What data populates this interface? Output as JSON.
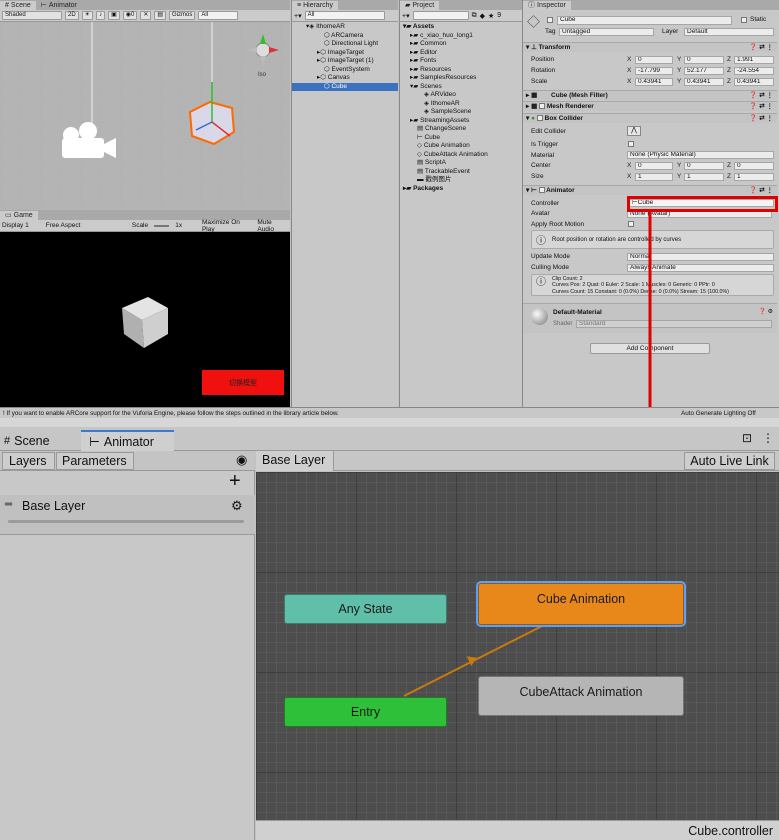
{
  "scene_view": {
    "tabs": [
      "Scene",
      "Animator"
    ],
    "toolbar": {
      "shading": "Shaded",
      "mode_2d": "2D",
      "count": "0",
      "gizmos": "Gizmos",
      "search": "All"
    },
    "iso_label": "Iso"
  },
  "game_view": {
    "tab": "Game",
    "display": "Display 1",
    "aspect": "Free Aspect",
    "scale_label": "Scale",
    "scale_value": "1x",
    "maximize": "Maximize On Play",
    "mute": "Mute Audio",
    "button_text": "切换模型"
  },
  "hierarchy": {
    "tab": "Hierarchy",
    "search": "All",
    "root": "IthomeAR",
    "items": [
      "ARCamera",
      "Directional Light",
      "ImageTarget",
      "ImageTarget (1)",
      "EventSystem",
      "Canvas",
      "Cube"
    ]
  },
  "project": {
    "tab": "Project",
    "count": "9",
    "assets_label": "Assets",
    "folders": [
      "c_xiao_huo_long1",
      "Common",
      "Editor",
      "Fonts",
      "Resources",
      "SamplesResources",
      "Scenes"
    ],
    "scenes": [
      "ARVideo",
      "IthomeAR",
      "SampleScene"
    ],
    "files": [
      "StreamingAssets",
      "ChangeScene",
      "Cube",
      "Cube Animation",
      "CubeAttack Animation",
      "ScriptA",
      "TrackableEvent",
      "戳例图片"
    ],
    "packages": "Packages"
  },
  "inspector": {
    "tab": "Inspector",
    "object_name": "Cube",
    "static_label": "Static",
    "tag_label": "Tag",
    "tag_value": "Untagged",
    "layer_label": "Layer",
    "layer_value": "Default",
    "transform": {
      "title": "Transform",
      "position_label": "Position",
      "position": [
        "0",
        "0",
        "1.991"
      ],
      "rotation_label": "Rotation",
      "rotation": [
        "-17.799",
        "52.177",
        "-24.554"
      ],
      "scale_label": "Scale",
      "scale": [
        "0.43941",
        "0.43941",
        "0.43941"
      ]
    },
    "mesh_filter": "Cube (Mesh Filter)",
    "mesh_renderer": "Mesh Renderer",
    "box_collider": {
      "title": "Box Collider",
      "edit_label": "Edit Collider",
      "trigger_label": "Is Trigger",
      "material_label": "Material",
      "material_value": "None (Physic Material)",
      "center_label": "Center",
      "center": [
        "0",
        "0",
        "0"
      ],
      "size_label": "Size",
      "size": [
        "1",
        "1",
        "1"
      ]
    },
    "animator": {
      "title": "Animator",
      "controller_label": "Controller",
      "controller_value": "Cube",
      "avatar_label": "Avatar",
      "avatar_value": "None (Avatar)",
      "root_motion_label": "Apply Root Motion",
      "info": "Root position or rotation are controlled by curves",
      "update_label": "Update Mode",
      "update_value": "Normal",
      "culling_label": "Culling Mode",
      "culling_value": "Always Animate",
      "stats": [
        "Clip Count: 2",
        "Curves Pos: 2 Quat: 0 Euler: 2 Scale: 1 Muscles: 0 Generic: 0 PPtr: 0",
        "Curves Count: 15 Constant: 0 (0.0%) Dense: 0 (0.0%) Stream: 15 (100.0%)"
      ]
    },
    "material": {
      "name": "Default-Material",
      "shader_label": "Shader",
      "shader_value": "Standard"
    },
    "add_component": "Add Component"
  },
  "status_bar": {
    "message": "If you want to enable ARCore support for the Vuforia Engine, please follow the steps outlined in the library article below.",
    "lighting": "Auto Generate Lighting Off"
  },
  "animator_window": {
    "tabs": [
      "Scene",
      "Animator"
    ],
    "layers_tab": "Layers",
    "parameters_tab": "Parameters",
    "breadcrumb": "Base Layer",
    "auto_live_link": "Auto Live Link",
    "layer_name": "Base Layer",
    "states": {
      "any_state": "Any State",
      "entry": "Entry",
      "cube_animation": "Cube Animation",
      "cubeattack_animation": "CubeAttack Animation"
    },
    "footer": "Cube.controller",
    "colors": {
      "any_state": "#5fbfa8",
      "entry": "#2fc03a",
      "default_state": "#e8881a",
      "state": "#b5b5b5",
      "highlight": "#e00000"
    }
  }
}
